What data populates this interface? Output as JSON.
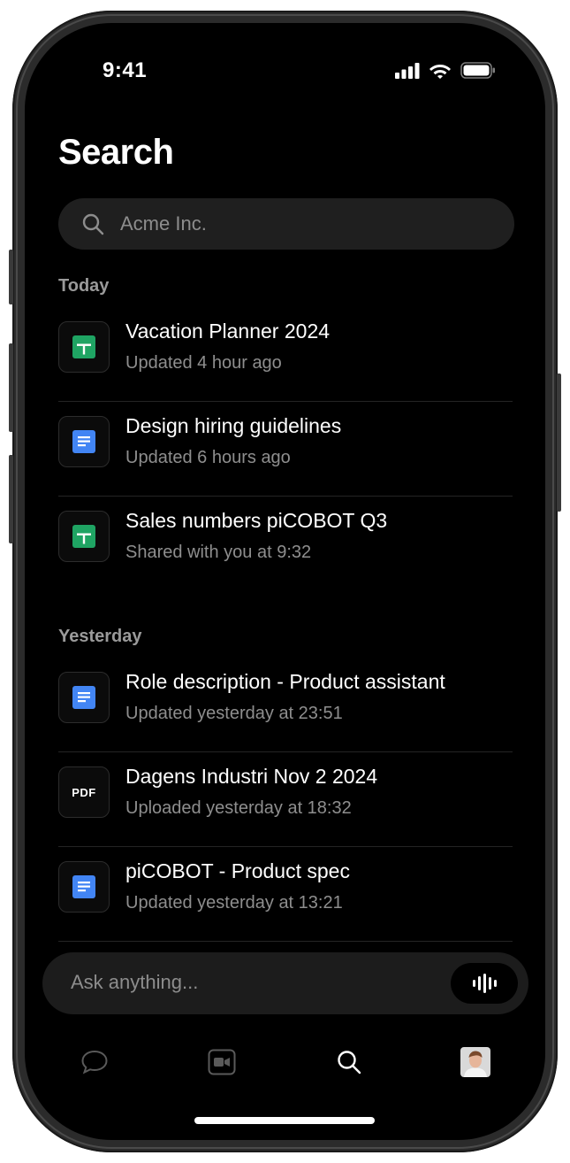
{
  "status_bar": {
    "time": "9:41"
  },
  "page": {
    "title": "Search"
  },
  "search": {
    "placeholder": "Acme Inc."
  },
  "sections": [
    {
      "label": "Today",
      "items": [
        {
          "title": "Vacation Planner 2024",
          "subtitle": "Updated 4 hour ago",
          "icon": "sheets-icon"
        },
        {
          "title": "Design hiring guidelines",
          "subtitle": "Updated 6 hours ago",
          "icon": "docs-icon"
        },
        {
          "title": "Sales numbers piCOBOT Q3",
          "subtitle": "Shared with you at 9:32",
          "icon": "sheets-icon"
        }
      ]
    },
    {
      "label": "Yesterday",
      "items": [
        {
          "title": "Role description - Product assistant",
          "subtitle": "Updated yesterday at 23:51",
          "icon": "docs-icon"
        },
        {
          "title": "Dagens Industri Nov 2 2024",
          "subtitle": "Uploaded yesterday at 18:32",
          "icon": "pdf-icon",
          "badge": "PDF"
        },
        {
          "title": "piCOBOT - Product spec",
          "subtitle": "Updated yesterday at 13:21",
          "icon": "docs-icon"
        }
      ]
    }
  ],
  "ask": {
    "placeholder": "Ask anything..."
  },
  "tab_bar": {
    "items": [
      "chat-icon",
      "video-icon",
      "search-icon",
      "profile-avatar"
    ],
    "active": "search-icon"
  },
  "colors": {
    "background": "#000000",
    "sheets_green": "#1fa463",
    "docs_blue": "#4285f4",
    "muted_text": "#8e8e8e"
  }
}
